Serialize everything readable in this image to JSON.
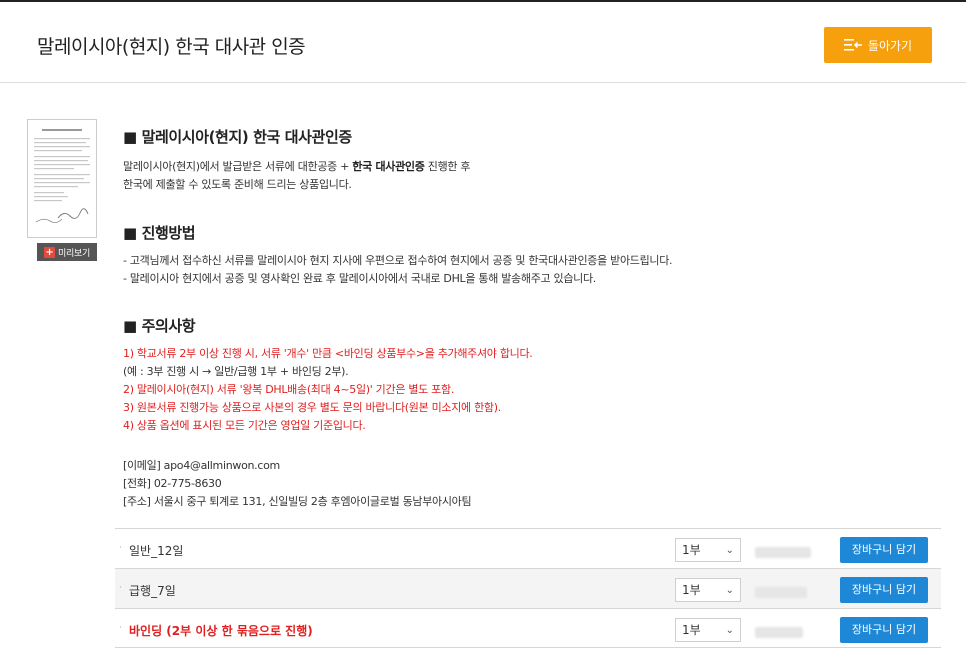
{
  "header": {
    "title": "말레이시아(현지) 한국 대사관 인증",
    "back_label": "돌아가기"
  },
  "thumbnail": {
    "preview_label": "미리보기"
  },
  "section1": {
    "heading": "■ 말레이시아(현지) 한국 대사관인증",
    "line1_pre": "말레이시아(현지)에서 발급받은 서류에 대한공증 + ",
    "line1_bold": "한국 대사관인증",
    "line1_post": " 진행한 후",
    "line2": "한국에 제출할 수 있도록 준비해 드리는 상품입니다."
  },
  "section2": {
    "heading": "■ 진행방법",
    "line1": "- 고객님께서 접수하신 서류를 말레이시아 현지 지사에 우편으로 접수하여 현지에서 공증 및 한국대사관인증을 받아드립니다.",
    "line2": "- 말레이시아 현지에서 공증 및 영사확인 완료 후 말레이시아에서 국내로 DHL을 통해 발송해주고 있습니다."
  },
  "section3": {
    "heading": "■ 주의사항",
    "note1": "1) 학교서류 2부 이상 진행 시, 서류 '개수' 만큼 <바인딩 상품부수>을 추가해주셔야 합니다.",
    "note1_ex": "(예 : 3부 진행 시 → 일반/급행 1부 + 바인딩 2부).",
    "note2": "2) 말레이시아(현지) 서류 '왕복 DHL배송(최대 4~5일)' 기간은 별도 포함.",
    "note3": "3) 원본서류 진행가능 상품으로 사본의 경우 별도 문의 바랍니다(원본 미소지에 한함).",
    "note4": "4) 상품 옵션에 표시된 모든 기간은 영업일 기준입니다."
  },
  "contact": {
    "email": "[이메일] apo4@allminwon.com",
    "phone": "[전화] 02-775-8630",
    "address": "[주소] 서울시 중구 퇴계로 131, 신일빌딩 2층 후엠아이글로벌 동남부아시아팀"
  },
  "options": [
    {
      "name": "일반_12일",
      "qty": "1부",
      "cart": "장바구니 담기"
    },
    {
      "name": "급행_7일",
      "qty": "1부",
      "cart": "장바구니 담기"
    },
    {
      "name": "바인딩 (2부 이상 한 묶음으로 진행)",
      "qty": "1부",
      "cart": "장바구니 담기"
    }
  ],
  "colors": {
    "accent_orange": "#f5a00c",
    "cart_blue": "#1e87d6",
    "notice_red": "#e02020"
  }
}
